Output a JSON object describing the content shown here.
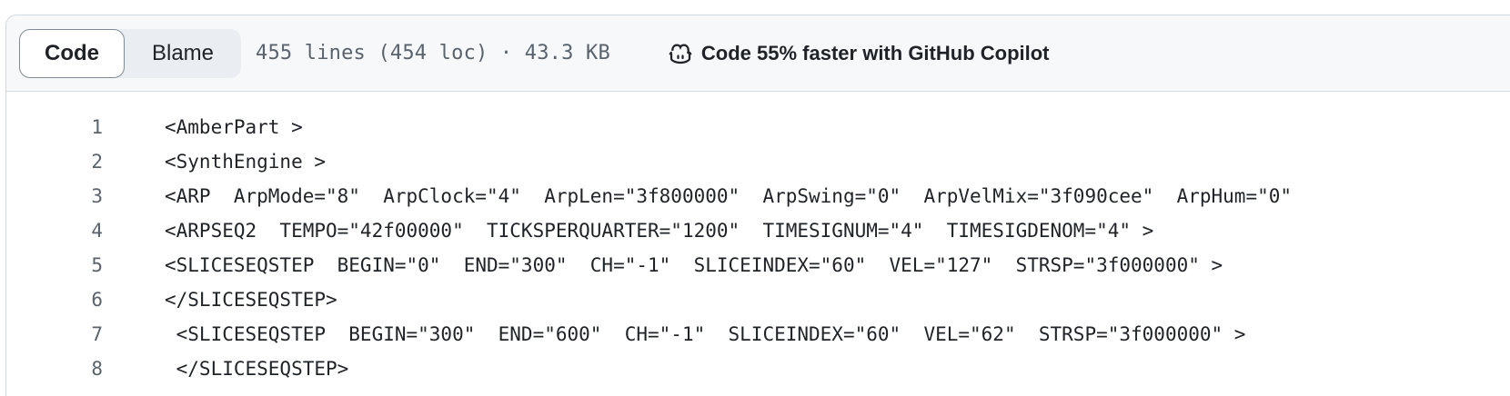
{
  "toolbar": {
    "code_tab": "Code",
    "blame_tab": "Blame",
    "file_info": "455 lines (454 loc) · 43.3 KB",
    "copilot_text": "Code 55% faster with GitHub Copilot"
  },
  "code_lines": [
    {
      "num": "1",
      "text": "<AmberPart >"
    },
    {
      "num": "2",
      "text": "<SynthEngine >"
    },
    {
      "num": "3",
      "text": "<ARP  ArpMode=\"8\"  ArpClock=\"4\"  ArpLen=\"3f800000\"  ArpSwing=\"0\"  ArpVelMix=\"3f090cee\"  ArpHum=\"0\""
    },
    {
      "num": "4",
      "text": "<ARPSEQ2  TEMPO=\"42f00000\"  TICKSPERQUARTER=\"1200\"  TIMESIGNUM=\"4\"  TIMESIGDENOM=\"4\" >"
    },
    {
      "num": "5",
      "text": "<SLICESEQSTEP  BEGIN=\"0\"  END=\"300\"  CH=\"-1\"  SLICEINDEX=\"60\"  VEL=\"127\"  STRSP=\"3f000000\" >"
    },
    {
      "num": "6",
      "text": "</SLICESEQSTEP>"
    },
    {
      "num": "7",
      "text": " <SLICESEQSTEP  BEGIN=\"300\"  END=\"600\"  CH=\"-1\"  SLICEINDEX=\"60\"  VEL=\"62\"  STRSP=\"3f000000\" >"
    },
    {
      "num": "8",
      "text": " </SLICESEQSTEP>"
    }
  ]
}
